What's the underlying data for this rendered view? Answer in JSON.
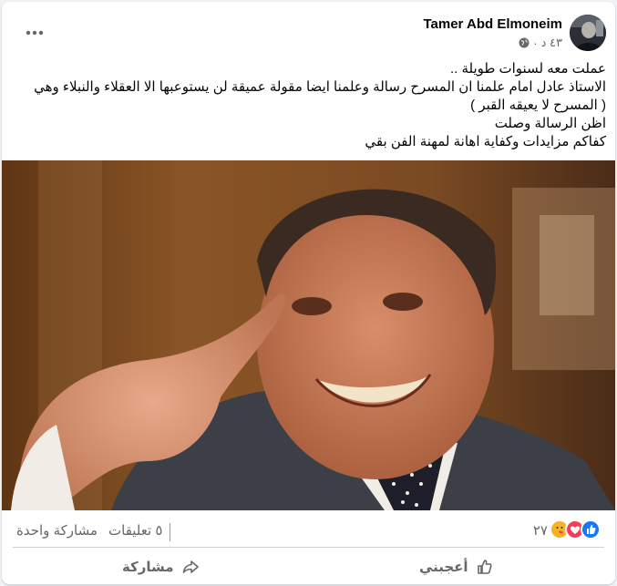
{
  "post": {
    "author": "Tamer Abd Elmoneim",
    "time": "٤٣ د",
    "privacy_icon": "globe-icon",
    "menu_icon": "more-options-icon",
    "text_lines": [
      "عملت معه لسنوات طويلة ..",
      "الاستاذ عادل امام علمنا ان المسرح رسالة وعلمنا ايضا مقولة عميقة لن يستوعبها الا العقلاء والنبلاء وهي",
      "( المسرح لا يعيقه القبر )",
      "اظن الرسالة وصلت",
      "كفاكم مزايدات وكفاية اهانة لمهنة الفن بقي"
    ]
  },
  "stats": {
    "reactions_count": "٢٧",
    "reaction_icons": [
      "like-reaction-icon",
      "love-reaction-icon",
      "care-reaction-icon"
    ],
    "comments": "٥ تعليقات",
    "shares": "مشاركة واحدة"
  },
  "actions": {
    "like": "أعجبني",
    "share": "مشاركة"
  },
  "colors": {
    "like_blue": "#1877f2",
    "love_red": "#f33e58",
    "care_yellow": "#f7b125",
    "secondary_text": "#65676b"
  }
}
